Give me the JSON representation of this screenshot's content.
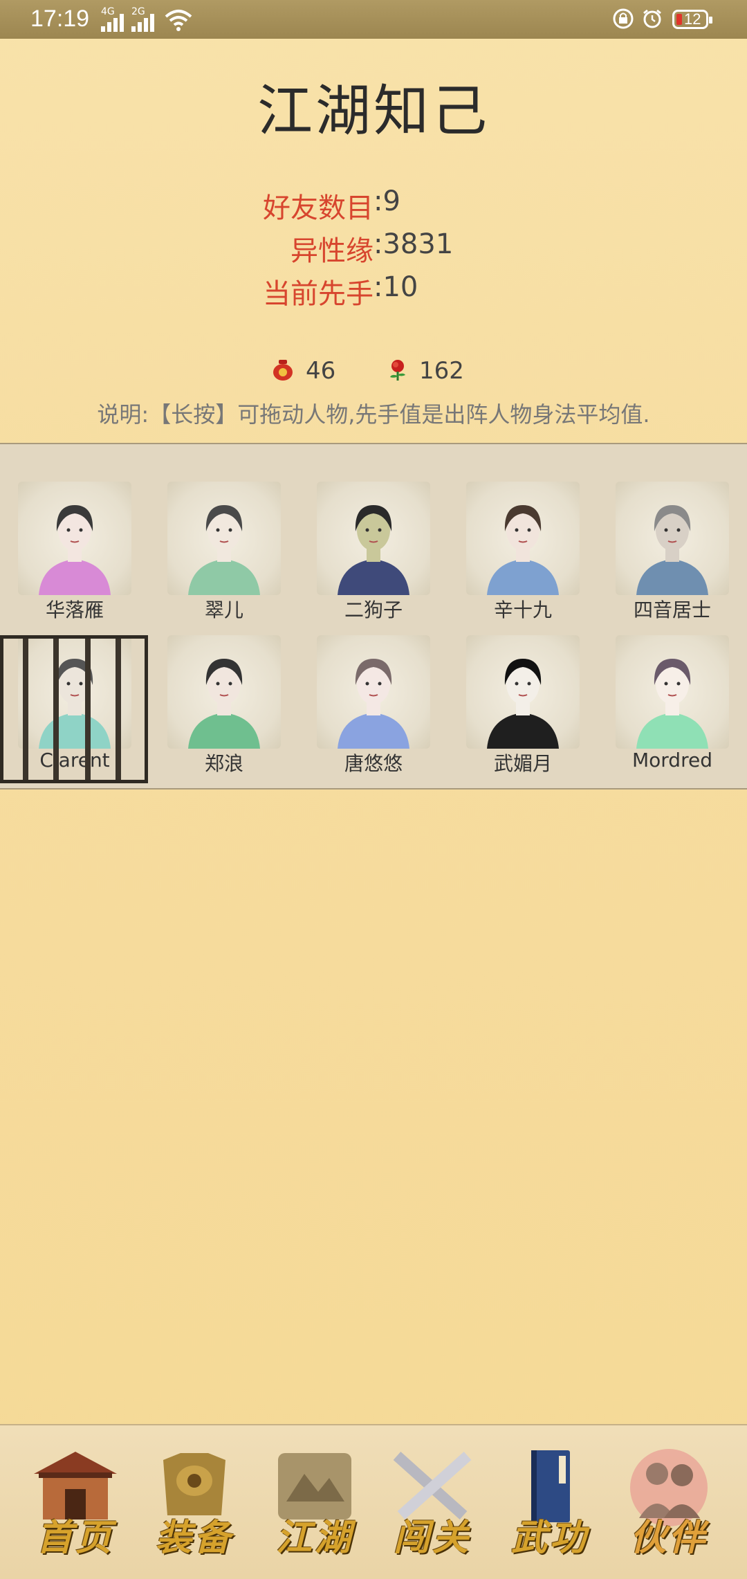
{
  "status_bar": {
    "time": "17:19",
    "network_1": "4G",
    "network_2": "2G",
    "battery": "12",
    "icons": [
      "signal-icon",
      "wifi-icon",
      "lock-icon",
      "alarm-icon",
      "battery-icon"
    ]
  },
  "page": {
    "title": "江湖知己"
  },
  "stats": [
    {
      "label": "好友数目",
      "value": ":9"
    },
    {
      "label": "异性缘",
      "value": ":3831"
    },
    {
      "label": "当前先手",
      "value": ":10"
    }
  ],
  "resources": [
    {
      "icon": "wine-jar-icon",
      "value": "46"
    },
    {
      "icon": "rose-icon",
      "value": "162"
    }
  ],
  "description": "说明:【长按】可拖动人物,先手值是出阵人物身法平均值.",
  "companions": [
    {
      "name": "华落雁",
      "robe": "#d88ad6",
      "hair": "#3a3a3a",
      "skin": "#f3e6e0",
      "locked": false
    },
    {
      "name": "翠儿",
      "robe": "#8fc9a6",
      "hair": "#4a4a4a",
      "skin": "#f1e8de",
      "locked": false
    },
    {
      "name": "二狗子",
      "robe": "#3f4a7a",
      "hair": "#2a2a2a",
      "skin": "#c9c89a",
      "locked": false
    },
    {
      "name": "辛十九",
      "robe": "#7ea1d0",
      "hair": "#4a3a30",
      "skin": "#f1e4dc",
      "locked": false
    },
    {
      "name": "四音居士",
      "robe": "#6f8fb0",
      "hair": "#8a8a8a",
      "skin": "#d8d0c6",
      "locked": false
    },
    {
      "name": "Clarent",
      "robe": "#8fd3c6",
      "hair": "#555555",
      "skin": "#ece5db",
      "locked": true
    },
    {
      "name": "郑浪",
      "robe": "#6fbf8f",
      "hair": "#333333",
      "skin": "#f1e6de",
      "locked": false
    },
    {
      "name": "唐悠悠",
      "robe": "#8aa3e0",
      "hair": "#7a6a6a",
      "skin": "#f4e8e4",
      "locked": false
    },
    {
      "name": "武媚月",
      "robe": "#1f1f1f",
      "hair": "#111111",
      "skin": "#f3efe8",
      "locked": false
    },
    {
      "name": "Mordred",
      "robe": "#8fe0b5",
      "hair": "#6a5a6a",
      "skin": "#f7efe8",
      "locked": false
    }
  ],
  "nav": [
    {
      "label": "首页",
      "icon": "house-icon",
      "active": false
    },
    {
      "label": "装备",
      "icon": "armor-icon",
      "active": false
    },
    {
      "label": "江湖",
      "icon": "scroll-map-icon",
      "active": false
    },
    {
      "label": "闯关",
      "icon": "crossed-swords-icon",
      "active": false
    },
    {
      "label": "武功",
      "icon": "book-icon",
      "active": false
    },
    {
      "label": "伙伴",
      "icon": "partners-icon",
      "active": true
    }
  ],
  "colors": {
    "accent_label": "#d7452e",
    "nav_gold": "#d6a22c",
    "background": "#f6dc9f"
  }
}
